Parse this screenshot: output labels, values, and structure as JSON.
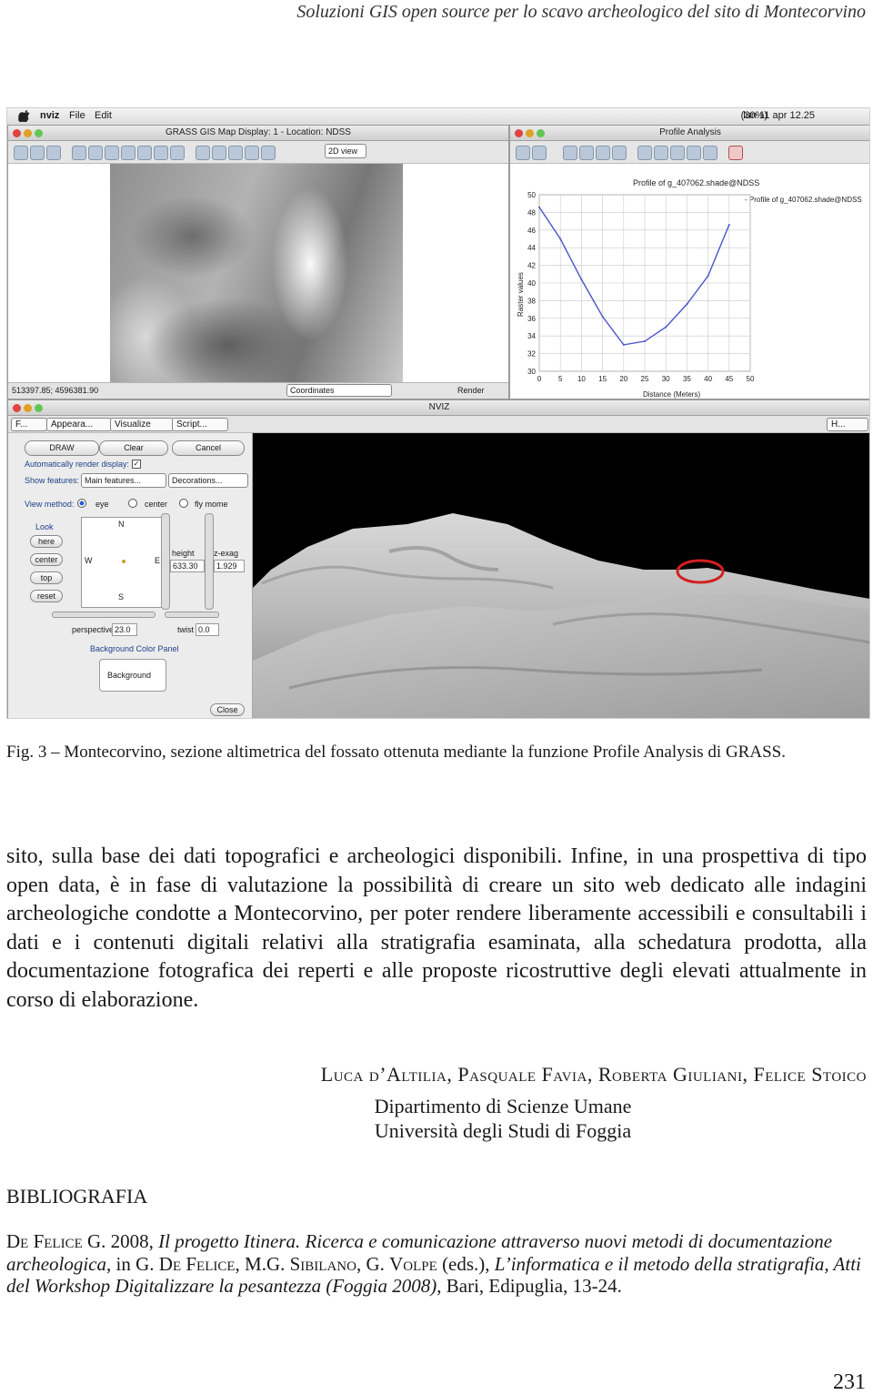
{
  "running_header": "Soluzioni GIS open source per lo scavo archeologico del sito di Montecorvino",
  "figure": {
    "menubar": {
      "app": "nviz",
      "file": "File",
      "edit": "Edit",
      "battery": "(30%)",
      "clock": "lun 11 apr 12.25"
    },
    "map_display": {
      "title": "GRASS GIS Map Display: 1 - Location: NDSS",
      "view_mode": "2D view",
      "coordinates": "513397.85; 4596381.90",
      "status_mode": "Coordinates",
      "render_label": "Render"
    },
    "profile_analysis": {
      "title": "Profile Analysis",
      "plot_title": "Profile of g_407062.shade@NDSS",
      "legend": "- Profile of g_407062.shade@NDSS",
      "chart_data": {
        "type": "line",
        "title": "Profile of g_407062.shade@NDSS",
        "xlabel": "Distance (Meters)",
        "ylabel": "Raster values",
        "xlim": [
          0,
          50
        ],
        "ylim": [
          30,
          50
        ],
        "xticks": [
          0,
          5,
          10,
          15,
          20,
          25,
          30,
          35,
          40,
          45,
          50
        ],
        "yticks": [
          30,
          32,
          34,
          36,
          38,
          40,
          42,
          44,
          46,
          48,
          50
        ],
        "grid": true,
        "series": [
          {
            "name": "Profile of g_407062.shade@NDSS",
            "color": "#4a55c8",
            "x": [
              0,
              5,
              10,
              15,
              20,
              25,
              30,
              35,
              40,
              45
            ],
            "y": [
              48.6,
              45.0,
              40.4,
              36.2,
              33.0,
              33.4,
              35.0,
              37.6,
              40.8,
              46.6
            ]
          }
        ]
      }
    },
    "nviz": {
      "title": "NVIZ",
      "menu_file": "F...",
      "menu_appearance": "Appeara...",
      "menu_visualize": "Visualize",
      "menu_script": "Script...",
      "menu_help": "H...",
      "btn_draw": "DRAW",
      "btn_clear": "Clear",
      "btn_cancel": "Cancel",
      "auto_render": "Automatically render display:",
      "show_features": "Show features:",
      "main_features": "Main features...",
      "decorations": "Decorations...",
      "view_method": "View method:",
      "view_eye": "eye",
      "view_center": "center",
      "view_fly": "fly mome",
      "look": "Look",
      "look_here": "here",
      "look_center": "center",
      "look_top": "top",
      "look_reset": "reset",
      "compass_n": "N",
      "compass_s": "S",
      "compass_e": "E",
      "compass_w": "W",
      "height_label": "height",
      "height_value": "633.30",
      "zexag_label": "z-exag",
      "zexag_value": "1.929",
      "perspective_label": "perspective",
      "perspective_value": "23.0",
      "twist_label": "twist",
      "twist_value": "0.0",
      "bg_panel": "Background Color Panel",
      "bg_button": "Background",
      "close": "Close"
    }
  },
  "caption": "Fig. 3 – Montecorvino, sezione altimetrica del fossato ottenuta mediante la funzione Profile Analysis di GRASS.",
  "body": "sito, sulla base dei dati topografici e archeologici disponibili. Infine, in una prospettiva di tipo open data, è in fase di valutazione la possibilità di creare un sito web dedicato alle indagini archeologiche condotte a Montecorvino, per poter rendere liberamente accessibili e consultabili i dati e i contenuti digitali relativi alla stratigrafia esaminata, alla schedatura prodotta, alla documentazione fotografica dei reperti e alle proposte ricostruttive degli elevati attualmente in corso di elaborazione.",
  "authors": "Luca d’Altilia, Pasquale Favia, Roberta Giuliani, Felice Stoico",
  "department": "Dipartimento di Scienze Umane",
  "university": "Università degli Studi di Foggia",
  "bibliography_heading": "BIBLIOGRAFIA",
  "bibliography": {
    "author": "De Felice G.",
    "year": " 2008, ",
    "title": "Il progetto Itinera. Ricerca e comunicazione attraverso nuovi metodi di documentazione archeologica",
    "in": ", in G. ",
    "editor1": "De Felice",
    "sep1": ", M.G. ",
    "editor2": "Sibilano",
    "sep2": ", G. ",
    "editor3": "Volpe",
    "eds": " (eds.), ",
    "book": "L’informatica e il metodo della stratigrafia, Atti del Workshop Digitalizzare la pesantezza (Foggia 2008)",
    "tail": ", Bari, Edipuglia, 13-24."
  },
  "page_number": "231"
}
